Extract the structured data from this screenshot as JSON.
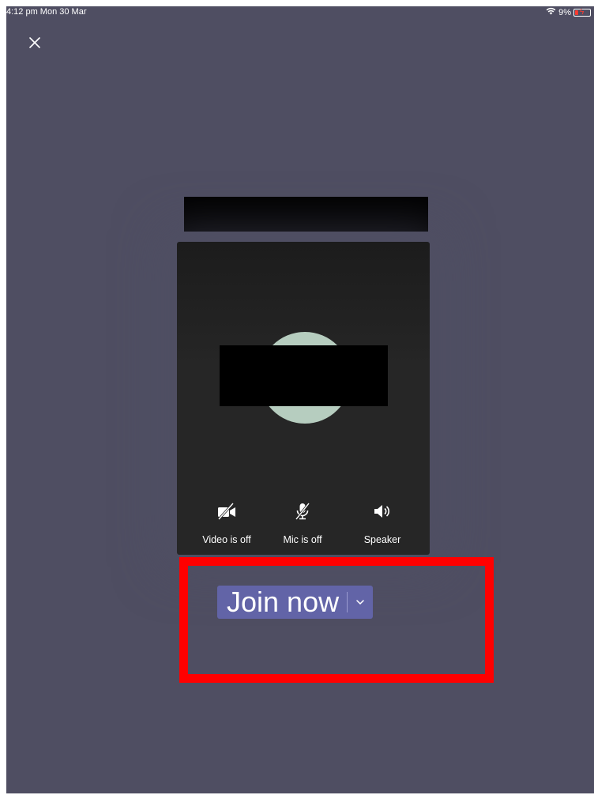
{
  "statusbar": {
    "time": "4:12 pm  Mon 30 Mar",
    "battery_percent": "9%"
  },
  "controls": [
    {
      "label": "Video is off",
      "icon": "video-off-icon"
    },
    {
      "label": "Mic is off",
      "icon": "mic-off-icon"
    },
    {
      "label": "Speaker",
      "icon": "speaker-icon"
    }
  ],
  "join": {
    "label": "Join now"
  },
  "colors": {
    "background": "#4f4e62",
    "accent": "#6264a7",
    "highlight": "#ff0000",
    "avatar": "#b6cdbf"
  }
}
